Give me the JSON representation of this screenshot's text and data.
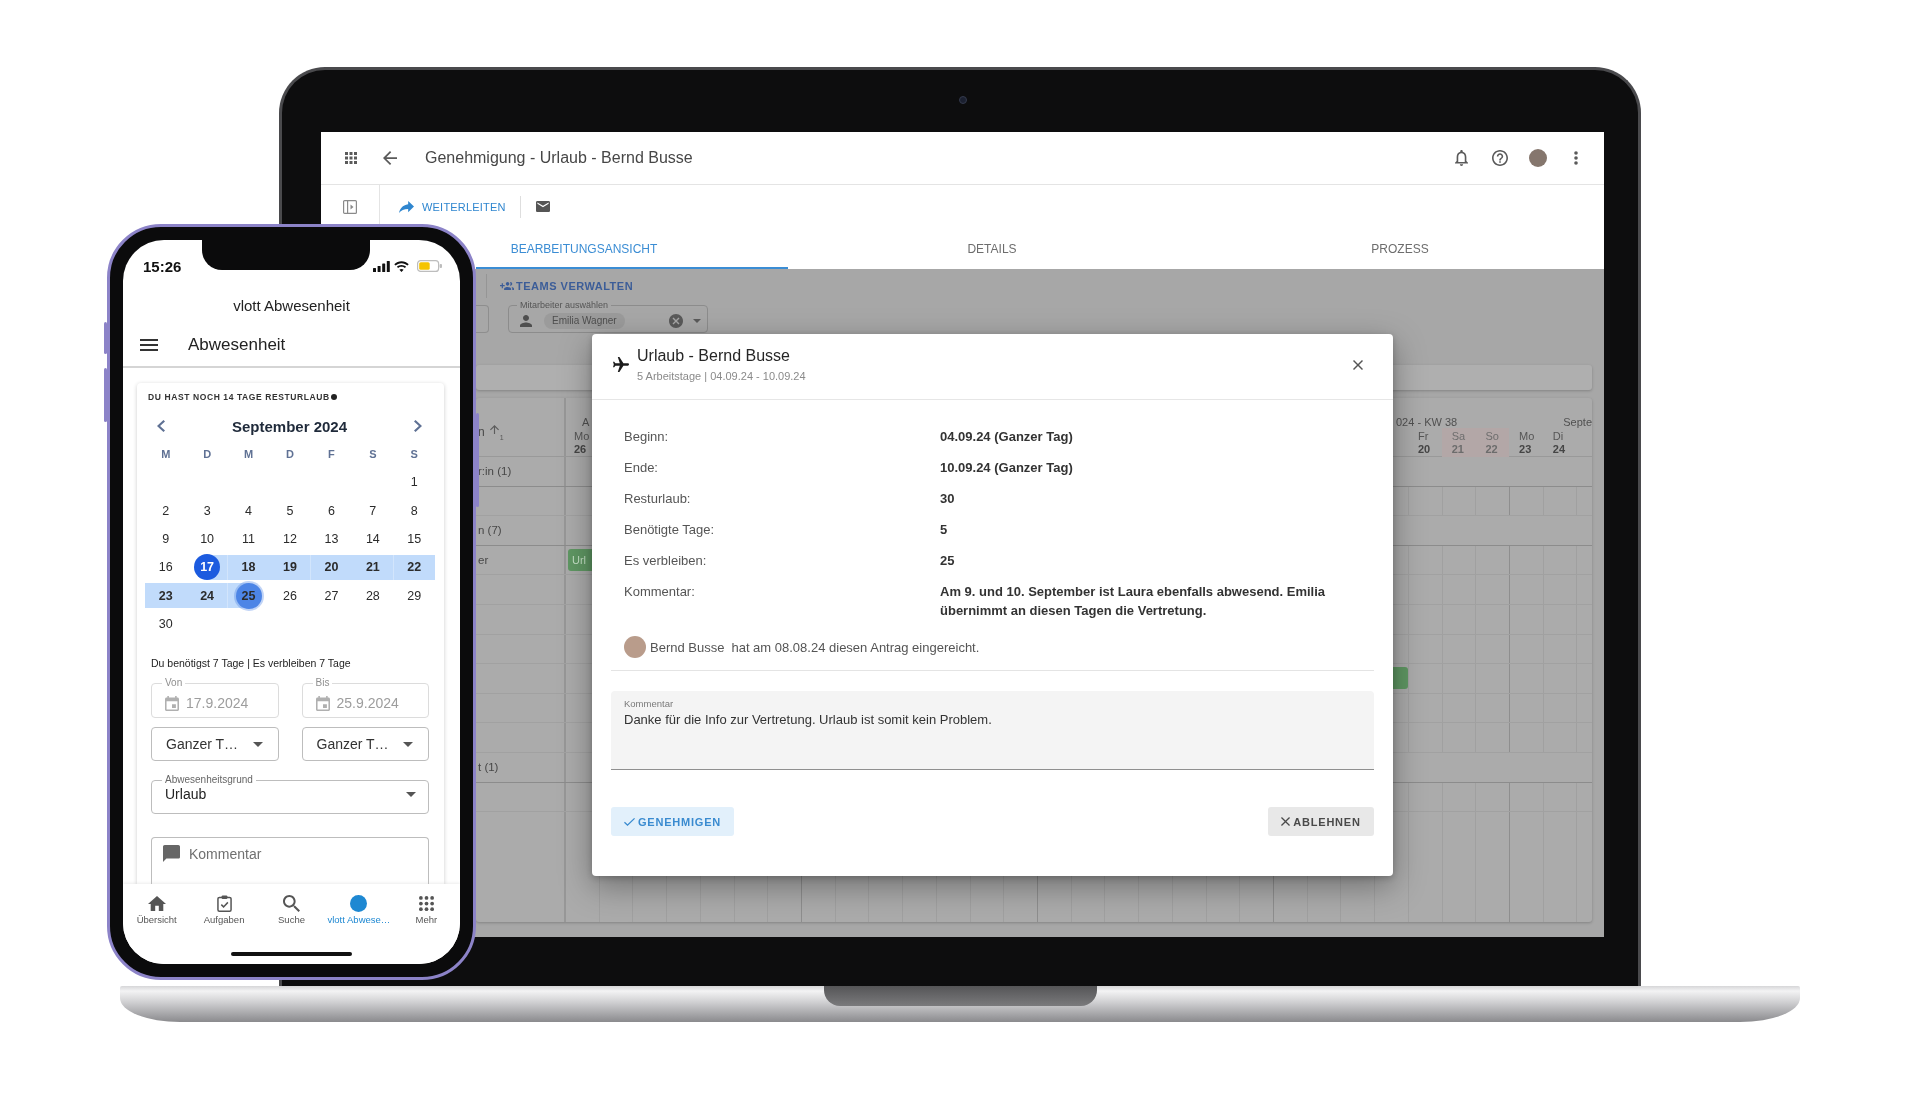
{
  "laptop": {
    "app_bar": {
      "title": "Genehmigung - Urlaub - Bernd Busse"
    },
    "toolbar": {
      "forward_button": "WEITERLEITEN"
    },
    "tabs": [
      {
        "label": "BEARBEITUNGSANSICHT",
        "selected": true
      },
      {
        "label": "DETAILS",
        "selected": false
      },
      {
        "label": "PROZESS",
        "selected": false
      }
    ],
    "planner": {
      "teams_button": "TEAMS VERWALTEN",
      "employee_select": {
        "label": "Mitarbeiter auswählen",
        "chips": [
          "Emilia Wagner"
        ]
      },
      "sort_column": {
        "label": "n",
        "rank": "1"
      },
      "weeks": [
        {
          "label": "A",
          "days": [
            {
              "weekday": "Mo",
              "date": "26",
              "weekend": false
            }
          ]
        },
        {
          "label": "024 - KW 38",
          "days": [
            {
              "weekday": "Fr",
              "date": "20",
              "weekend": false
            },
            {
              "weekday": "Sa",
              "date": "21",
              "weekend": true
            },
            {
              "weekday": "So",
              "date": "22",
              "weekend": true
            }
          ]
        },
        {
          "label": "Septe",
          "days": [
            {
              "weekday": "Mo",
              "date": "23",
              "weekend": false
            },
            {
              "weekday": "Di",
              "date": "24",
              "weekend": false
            }
          ]
        }
      ],
      "rows": [
        {
          "kind": "group",
          "label": "r:in (1)"
        },
        {
          "kind": "person"
        },
        {
          "kind": "group",
          "label": "n (7)"
        },
        {
          "kind": "person",
          "label": "er",
          "absence": {
            "kind": "start",
            "label": "Url"
          }
        },
        {
          "kind": "person"
        },
        {
          "kind": "person"
        },
        {
          "kind": "person"
        },
        {
          "kind": "person",
          "absence": {
            "kind": "end"
          }
        },
        {
          "kind": "person"
        },
        {
          "kind": "person"
        },
        {
          "kind": "group",
          "label": "t (1)"
        },
        {
          "kind": "person"
        },
        {
          "kind": "person"
        }
      ]
    },
    "dialog": {
      "title": "Urlaub - Bernd Busse",
      "subtitle": "5 Arbeitstage | 04.09.24 - 10.09.24",
      "details": [
        {
          "label": "Beginn:",
          "value": "04.09.24 (Ganzer Tag)"
        },
        {
          "label": "Ende:",
          "value": "10.09.24 (Ganzer Tag)"
        },
        {
          "label": "Resturlaub:",
          "value": "30"
        },
        {
          "label": "Benötigte Tage:",
          "value": "5"
        },
        {
          "label": "Es verbleiben:",
          "value": "25"
        },
        {
          "label": "Kommentar:",
          "value": "Am 9. und 10. September ist Laura ebenfalls abwesend. Emilia übernimmt an diesen Tagen die Vertretung."
        }
      ],
      "submitted": {
        "name": "Bernd Busse",
        "text": "hat am 08.08.24 diesen Antrag eingereicht."
      },
      "comment": {
        "label": "Kommentar",
        "value": "Danke für die Info zur Vertretung. Urlaub ist somit kein Problem."
      },
      "actions": [
        {
          "label": "GENEHMIGEN",
          "kind": "approve"
        },
        {
          "label": "ABLEHNEN",
          "kind": "reject"
        }
      ]
    }
  },
  "phone": {
    "status_bar": {
      "time": "15:26"
    },
    "app_name": "vlott Abwesenheit",
    "page_title": "Abwesenheit",
    "remaining_note": "DU HAST NOCH 14 TAGE RESTURLAUB",
    "calendar": {
      "month": "September 2024",
      "weekdays": [
        "M",
        "D",
        "M",
        "D",
        "F",
        "S",
        "S"
      ],
      "weeks": [
        [
          {
            "day": "1",
            "selected": false,
            "in_range": false,
            "focused": false
          }
        ],
        [
          {
            "day": "2",
            "selected": false,
            "in_range": false,
            "focused": false
          },
          {
            "day": "3",
            "selected": false,
            "in_range": false,
            "focused": false
          },
          {
            "day": "4",
            "selected": false,
            "in_range": false,
            "focused": false
          },
          {
            "day": "5",
            "selected": false,
            "in_range": false,
            "focused": false
          },
          {
            "day": "6",
            "selected": false,
            "in_range": false,
            "focused": false
          },
          {
            "day": "7",
            "selected": false,
            "in_range": false,
            "focused": false
          },
          {
            "day": "8",
            "selected": false,
            "in_range": false,
            "focused": false
          }
        ],
        [
          {
            "day": "9",
            "selected": false,
            "in_range": false,
            "focused": false
          },
          {
            "day": "10",
            "selected": false,
            "in_range": false,
            "focused": false
          },
          {
            "day": "11",
            "selected": false,
            "in_range": false,
            "focused": false
          },
          {
            "day": "12",
            "selected": false,
            "in_range": false,
            "focused": false
          },
          {
            "day": "13",
            "selected": false,
            "in_range": false,
            "focused": false
          },
          {
            "day": "14",
            "selected": false,
            "in_range": false,
            "focused": false
          },
          {
            "day": "15",
            "selected": false,
            "in_range": false,
            "focused": false
          }
        ],
        [
          {
            "day": "16",
            "selected": false,
            "in_range": false,
            "focused": false
          },
          {
            "day": "17",
            "selected": true,
            "in_range": true,
            "focused": false
          },
          {
            "day": "18",
            "selected": false,
            "in_range": true,
            "focused": false
          },
          {
            "day": "19",
            "selected": false,
            "in_range": true,
            "focused": false
          },
          {
            "day": "20",
            "selected": false,
            "in_range": true,
            "focused": false
          },
          {
            "day": "21",
            "selected": false,
            "in_range": true,
            "focused": false
          },
          {
            "day": "22",
            "selected": false,
            "in_range": true,
            "focused": false
          }
        ],
        [
          {
            "day": "23",
            "selected": false,
            "in_range": true,
            "focused": false
          },
          {
            "day": "24",
            "selected": false,
            "in_range": true,
            "focused": false
          },
          {
            "day": "25",
            "selected": true,
            "in_range": true,
            "focused": true
          },
          {
            "day": "26",
            "selected": false,
            "in_range": false,
            "focused": false
          },
          {
            "day": "27",
            "selected": false,
            "in_range": false,
            "focused": false
          },
          {
            "day": "28",
            "selected": false,
            "in_range": false,
            "focused": false
          },
          {
            "day": "29",
            "selected": false,
            "in_range": false,
            "focused": false
          }
        ],
        [
          {
            "day": "30",
            "selected": false,
            "in_range": false,
            "focused": false
          }
        ]
      ]
    },
    "summary": "Du benötigst 7 Tage | Es verbleiben 7 Tage",
    "date_fields": [
      {
        "label": "Von",
        "value": "17.9.2024",
        "disabled": true
      },
      {
        "label": "Bis",
        "value": "25.9.2024",
        "disabled": true
      }
    ],
    "day_part_selects": [
      {
        "value": "Ganzer T…"
      },
      {
        "value": "Ganzer T…"
      }
    ],
    "reason_select": {
      "label": "Abwesenheitsgrund",
      "value": "Urlaub"
    },
    "comment_field": {
      "placeholder": "Kommentar"
    },
    "bottom_nav": [
      {
        "label": "Übersicht",
        "selected": false
      },
      {
        "label": "Aufgaben",
        "selected": false
      },
      {
        "label": "Suche",
        "selected": false
      },
      {
        "label": "vlott Abwese…",
        "selected": true
      },
      {
        "label": "Mehr",
        "selected": false
      }
    ]
  }
}
